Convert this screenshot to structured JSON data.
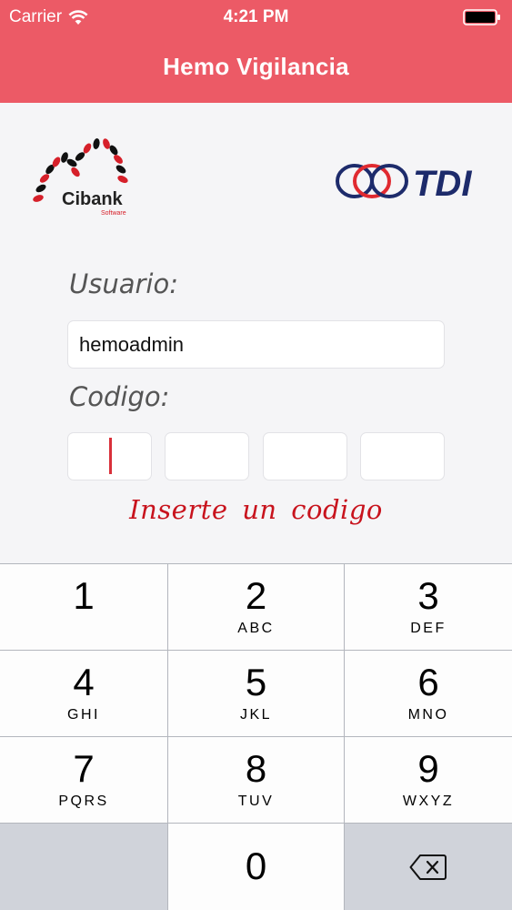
{
  "status_bar": {
    "carrier": "Carrier",
    "time": "4:21 PM"
  },
  "nav": {
    "title": "Hemo Vigilancia"
  },
  "logos": {
    "cibank_name": "Cibank",
    "cibank_sub": "Software",
    "tdi_name": "TDI"
  },
  "form": {
    "user_label": "Usuario:",
    "user_value": "hemoadmin",
    "code_label": "Codigo:",
    "code_digits": [
      "",
      "",
      "",
      ""
    ],
    "hint": "Inserte un codigo"
  },
  "keypad": {
    "keys": [
      {
        "num": "1",
        "letters": ""
      },
      {
        "num": "2",
        "letters": "ABC"
      },
      {
        "num": "3",
        "letters": "DEF"
      },
      {
        "num": "4",
        "letters": "GHI"
      },
      {
        "num": "5",
        "letters": "JKL"
      },
      {
        "num": "6",
        "letters": "MNO"
      },
      {
        "num": "7",
        "letters": "PQRS"
      },
      {
        "num": "8",
        "letters": "TUV"
      },
      {
        "num": "9",
        "letters": "WXYZ"
      },
      {
        "num": "0",
        "letters": ""
      }
    ],
    "delete_icon": "backspace-icon"
  },
  "colors": {
    "accent": "#ec5a66",
    "hint": "#c8131d",
    "caret": "#d9303a"
  }
}
